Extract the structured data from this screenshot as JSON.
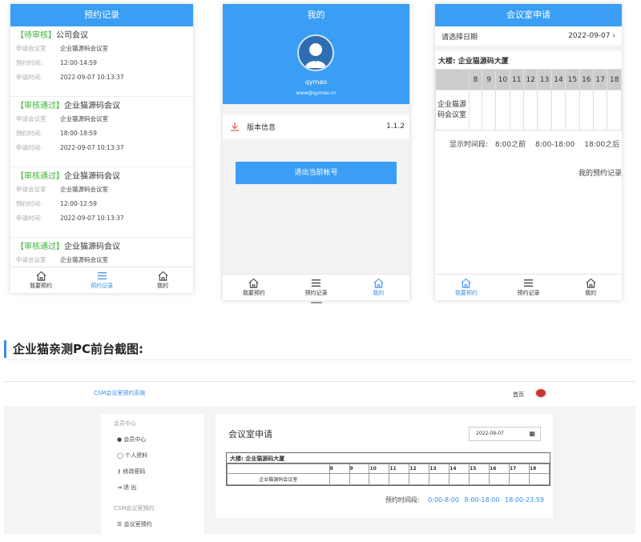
{
  "phone1": {
    "header": "预约记录",
    "records": [
      {
        "status": "【待审核】",
        "title": "公司会议",
        "room_label": "申请会议室",
        "room": "企业猫源码会议室",
        "time_label": "预约时间:",
        "time": "12:00-14:59",
        "apply_label": "申请时间:",
        "apply": "2022-09-07 10:13:37"
      },
      {
        "status": "【审核通过】",
        "title": "企业猫源码会议",
        "room_label": "申请会议室",
        "room": "企业猫源码会议室",
        "time_label": "预约时间:",
        "time": "18:00-18:59",
        "apply_label": "申请时间:",
        "apply": "2022-09-07 10:13:37"
      },
      {
        "status": "【审核通过】",
        "title": "企业猫源码会议",
        "room_label": "申请会议室",
        "room": "企业猫源码会议室",
        "time_label": "预约时间:",
        "time": "12:00-12:59",
        "apply_label": "申请时间:",
        "apply": "2022-09-07 10:13:37"
      },
      {
        "status": "【审核通过】",
        "title": "企业猫源码会议",
        "room_label": "申请会议室",
        "room": "企业猫源码会议室"
      }
    ],
    "nav": [
      "我要预约",
      "预约记录",
      "我的"
    ]
  },
  "phone2": {
    "header": "我的",
    "username": "qymao",
    "email": "www@qymao.cn",
    "version_label": "版本信息",
    "version": "1.1.2",
    "logout": "退出当前帐号",
    "nav": [
      "我要预约",
      "预约记录",
      "我的"
    ]
  },
  "phone3": {
    "header": "会议室申请",
    "date_label": "请选择日期",
    "date": "2022-09-07",
    "building": "大楼:  企业猫源码大厦",
    "hours": [
      "8",
      "9",
      "10",
      "11",
      "12",
      "13",
      "14",
      "15",
      "16",
      "17",
      "18"
    ],
    "room": "企业猫源码会议室",
    "legend_label": "显示时间段:",
    "legend": [
      "8:00之前",
      "8:00-18:00",
      "18:00之后"
    ],
    "my_records": "我的预约记录",
    "nav": [
      "我要预约",
      "预约记录",
      "我的"
    ]
  },
  "section_heading": "企业猫亲测PC前台截图:",
  "pc": {
    "brand": "CSM会议室预约系统",
    "home": "首页",
    "side_groups": [
      {
        "title": "会员中心",
        "items": [
          "会员中心",
          "个人资料",
          "修改密码",
          "退 出"
        ]
      },
      {
        "title": "CSM会议室预约",
        "items": [
          "会议室预约"
        ]
      }
    ],
    "title": "会议室申请",
    "date": "2022-09-07",
    "building": "大楼:  企业猫源码大厦",
    "hours": [
      "8",
      "9",
      "10",
      "11",
      "12",
      "13",
      "14",
      "15",
      "16",
      "17",
      "18"
    ],
    "room": "企业猫源码会议室",
    "legend_label": "预约时间段:",
    "legend": [
      "0:00-8:00",
      "8:00-18:00",
      "18:00-23:59"
    ]
  },
  "colors": {
    "primary": "#3a9ef5",
    "approved": "#3db33a",
    "link": "#3a8ee6"
  }
}
